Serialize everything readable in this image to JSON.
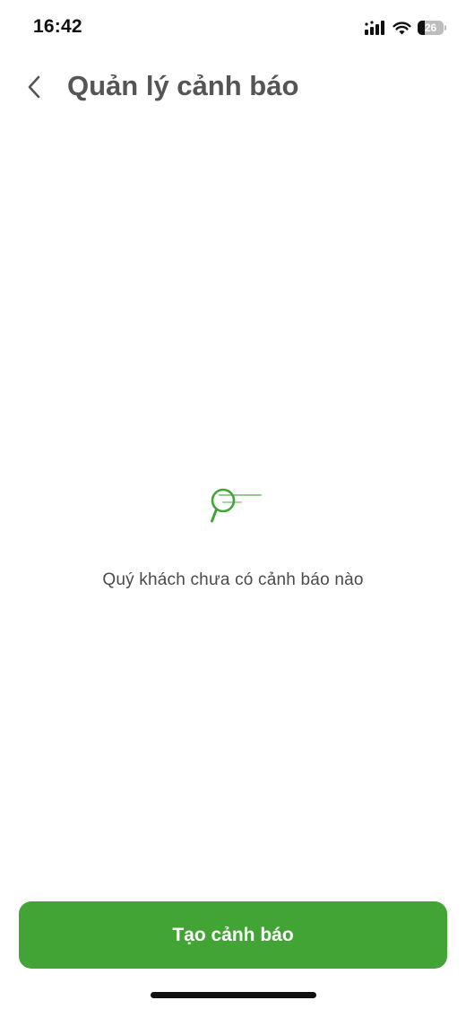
{
  "status_bar": {
    "time": "16:42",
    "signal_icon": "signal-bars-icon",
    "wifi_icon": "wifi-icon",
    "battery_icon": "battery-icon",
    "battery_level": "26",
    "battery_fraction": 0.26
  },
  "header": {
    "back_icon": "chevron-left-icon",
    "title": "Quản lý cảnh báo"
  },
  "empty_state": {
    "icon": "search-magnifier-icon",
    "message": "Quý khách chưa có cảnh báo nào"
  },
  "actions": {
    "create_alert_label": "Tạo cảnh báo"
  },
  "colors": {
    "accent": "#43a436",
    "title_text": "#555555",
    "body_text": "#4a4a4a",
    "background": "#ffffff"
  }
}
